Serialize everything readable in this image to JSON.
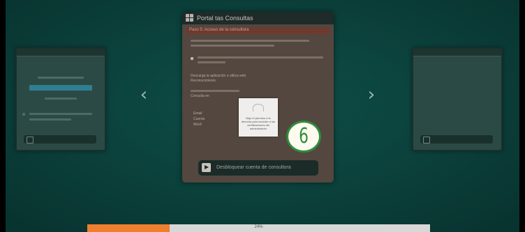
{
  "card": {
    "title": "Portal tas Consultas",
    "section_title": "Paso 5: Acceso de la consultora",
    "line_a": "Descarga la aplicación o utiliza web",
    "line_b": "Reconocimiento",
    "line_c": "Consulta en",
    "list_items": [
      "Email",
      "Cuenta",
      "Móvil"
    ],
    "action_label": "Desbloquear cuenta de consultora"
  },
  "popup": {
    "caption": "Bajo el permiso a la derecha para acceder a las certificaciones del administrador"
  },
  "step_badge": {
    "number": "6",
    "color": "#2f8d3b"
  },
  "navigation": {
    "prev": "‹",
    "next": "›"
  },
  "progress": {
    "value_percent": 24,
    "label": "24%",
    "fill_color": "#ef7f2e"
  },
  "icons": [
    "grid-icon",
    "play-icon",
    "chevron-left-icon",
    "chevron-right-icon"
  ]
}
